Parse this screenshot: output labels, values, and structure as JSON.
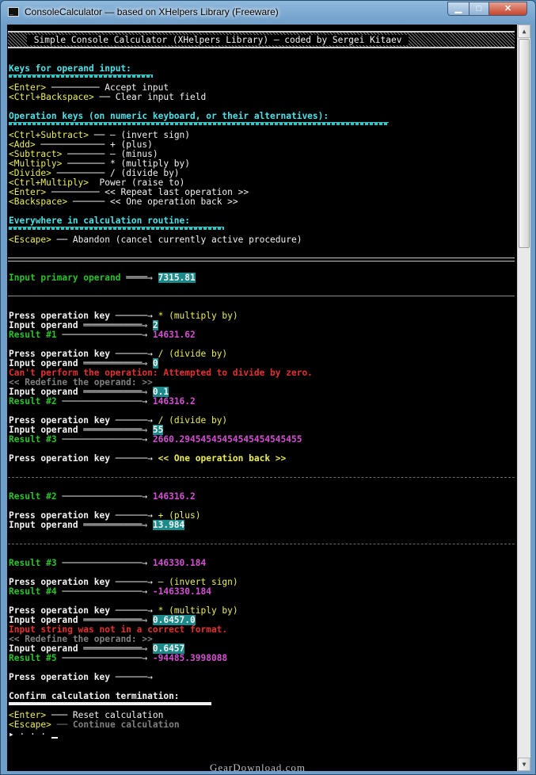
{
  "window": {
    "title": "ConsoleCalculator — based on XHelpers Library (Freeware)"
  },
  "controls": {
    "minimize": "▁",
    "maximize": "□",
    "close": "✕"
  },
  "banner": " Simple Console Calculator (XHelpers Library) — coded by Sergei Kitaev ",
  "help": {
    "operand_heading": "Keys for operand input:",
    "operand_keys": [
      {
        "key": "<Enter>",
        "lead": " ───────── ",
        "desc": "Accept input"
      },
      {
        "key": "<Ctrl+Backspace>",
        "lead": " ── ",
        "desc": "Clear input field"
      }
    ],
    "operation_heading": "Operation keys (on numeric keyboard, or their alternatives):",
    "operation_keys": [
      {
        "key": "<Ctrl+Subtract>",
        "lead": " ── ",
        "desc": "– (invert sign)"
      },
      {
        "key": "<Add>",
        "lead": " ──────────── ",
        "desc": "+ (plus)"
      },
      {
        "key": "<Subtract>",
        "lead": " ─────── ",
        "desc": "– (minus)"
      },
      {
        "key": "<Multiply>",
        "lead": " ─────── ",
        "desc": "* (multiply by)"
      },
      {
        "key": "<Divide>",
        "lead": " ───────── ",
        "desc": "/ (divide by)"
      },
      {
        "key": "<Ctrl+Multiply>",
        "lead": "  ",
        "desc": "Power (raise to)"
      },
      {
        "key": "<Enter>",
        "lead": " ───────── ",
        "desc": "<< Repeat last operation >>"
      },
      {
        "key": "<Backspace>",
        "lead": " ────── ",
        "desc": "<< One operation back >>"
      }
    ],
    "everywhere_heading": "Everywhere in calculation routine:",
    "escape": {
      "key": "<Escape>",
      "lead": " ── ",
      "desc": "Abandon (cancel currently active procedure)"
    }
  },
  "labels": {
    "input_primary": "Input primary operand",
    "press_key": "Press operation key",
    "input_operand": "Input operand",
    "redefine": "<< Redefine the operand: >>",
    "arrow_press": " ──────→ ",
    "arrow_input": " ═══════════⇒ ",
    "arrow_primary": " ════⇒ ",
    "arrow_result": " ───────────────→ "
  },
  "session": {
    "primary": "7315.81",
    "op1": "* (multiply by)",
    "in1": "2",
    "r1_label": "Result #1",
    "r1": "14631.62",
    "op2": "/ (divide by)",
    "in2": "0",
    "error_div": "Can't perform the operation: Attempted to divide by zero.",
    "in2b": "0.1",
    "r2_label": "Result #2",
    "r2": "146316.2",
    "op3": "/ (divide by)",
    "in3": "55",
    "r3_label": "Result #3",
    "r3": "2660.29454545454545454545455",
    "op_back": "<< One operation back >>",
    "b_r2_label": "Result #2",
    "b_r2": "146316.2",
    "op4": "+ (plus)",
    "in4": "13.984",
    "c_r3_label": "Result #3",
    "c_r3": "146330.184",
    "op5": "– (invert sign)",
    "r4_label": "Result #4",
    "r4": "-146330.184",
    "op6": "* (multiply by)",
    "in6": "0.6457.0",
    "error_format": "Input string was not in a correct format.",
    "in6b": "0.6457",
    "r5_label": "Result #5",
    "r5": "-94485.3998088"
  },
  "confirm": {
    "heading": "Confirm calculation termination:",
    "enter": {
      "key": "<Enter>",
      "lead": " ─── ",
      "desc": "Reset calculation"
    },
    "escape": {
      "key": "<Escape>",
      "lead": " ── ",
      "desc": "Continue calculation"
    },
    "prompt": "▸ · · · "
  },
  "watermark": "GearDownload.com"
}
